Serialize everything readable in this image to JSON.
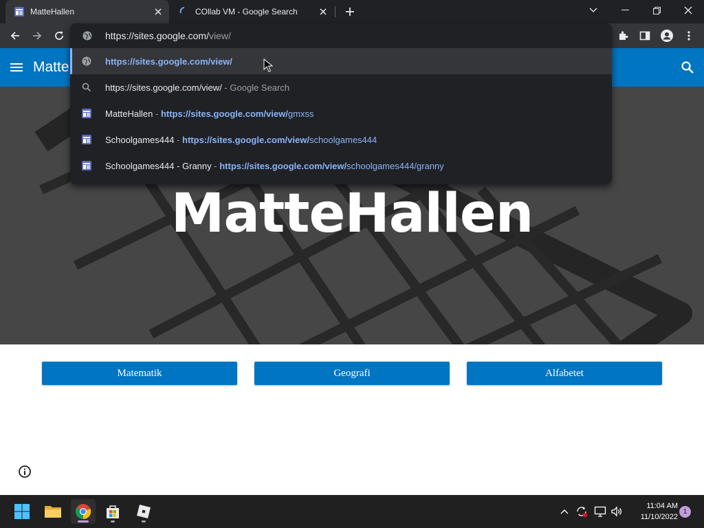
{
  "browser": {
    "tabs": [
      {
        "title": "MatteHallen",
        "active": true
      },
      {
        "title": "COllab VM - Google Search",
        "active": false,
        "loading": true
      }
    ],
    "omnibox": {
      "typed": "https://sites.google.com/",
      "typed_dim": "view/",
      "suggestions": [
        {
          "icon": "globe-icon",
          "title": "",
          "url_bold": "https://sites.google.com/view/",
          "url_rest": "",
          "suffix": "",
          "selected": true
        },
        {
          "icon": "search-icon",
          "title": "https://sites.google.com/view/",
          "url_bold": "",
          "url_rest": "",
          "suffix": "Google Search",
          "selected": false
        },
        {
          "icon": "sites-icon",
          "title": "MatteHallen",
          "url_bold": "https://sites.google.com/view/",
          "url_rest": "gmxss",
          "suffix": "",
          "selected": false
        },
        {
          "icon": "sites-icon",
          "title": "Schoolgames444",
          "url_bold": "https://sites.google.com/view/",
          "url_rest": "schoolgames444",
          "suffix": "",
          "selected": false
        },
        {
          "icon": "sites-icon",
          "title": "Schoolgames444 - Granny",
          "url_bold": "https://sites.google.com/view/",
          "url_rest": "schoolgames444/granny",
          "suffix": "",
          "selected": false
        }
      ],
      "separator": " - "
    }
  },
  "site": {
    "header_title": "Matte",
    "hero_title": "MatteHallen",
    "buttons": [
      "Matematik",
      "Geografi",
      "Alfabetet"
    ]
  },
  "taskbar": {
    "time": "11:04 AM",
    "date": "11/10/2022",
    "notification_count": "1"
  },
  "colors": {
    "site_accent": "#0075c2",
    "link_blue": "#8ab4f8",
    "browser_dark": "#202124",
    "browser_toolbar": "#35363a"
  }
}
